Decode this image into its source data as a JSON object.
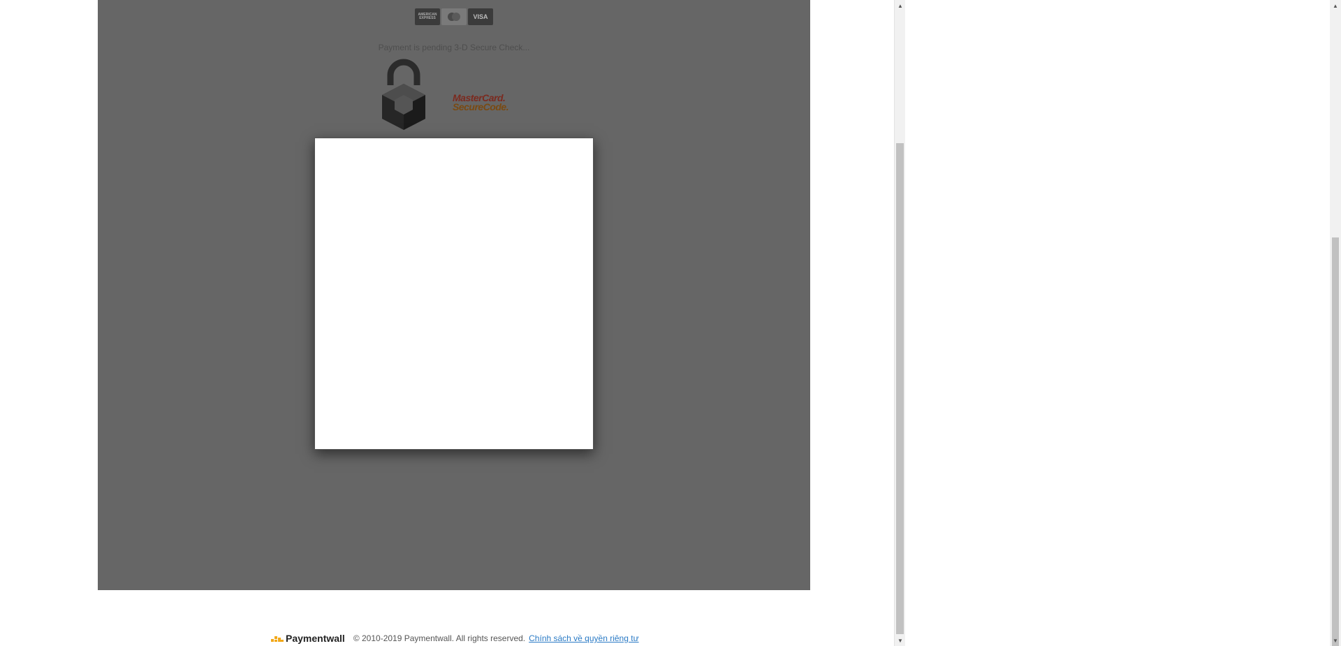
{
  "payment": {
    "status_text": "Payment is pending 3-D Secure Check...",
    "cards": [
      {
        "label": "AMERICAN EXPRESS",
        "icon": "amex-card-icon"
      },
      {
        "label": "",
        "icon": "mastercard-card-icon"
      },
      {
        "label": "VISA",
        "icon": "visa-card-icon"
      }
    ],
    "secure_logo": {
      "line1": "MasterCard.",
      "line2": "SecureCode."
    }
  },
  "footer": {
    "brand": "Paymentwall",
    "copyright": "© 2010-2019 Paymentwall. All rights reserved.",
    "privacy_link": "Chính sách về quyền riêng tư"
  },
  "colors": {
    "overlay": "#666666",
    "link": "#2a7ac5",
    "brand_icon": "#f2a818"
  }
}
